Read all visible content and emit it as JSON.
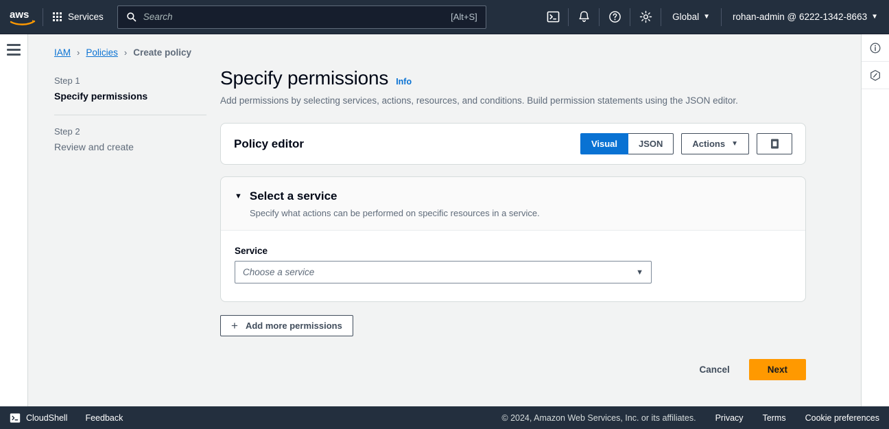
{
  "topnav": {
    "logo_alt": "aws",
    "services_label": "Services",
    "search": {
      "placeholder": "Search",
      "value": "",
      "shortcut": "[Alt+S]"
    },
    "icons": [
      "cloudshell-icon",
      "notifications-bell-icon",
      "help-circle-icon",
      "settings-gear-icon"
    ],
    "region_label": "Global",
    "account_label": "rohan-admin @ 6222-1342-8663",
    "caret": "▼"
  },
  "breadcrumb": {
    "items": [
      {
        "label": "IAM",
        "link": true
      },
      {
        "label": "Policies",
        "link": true
      },
      {
        "label": "Create policy",
        "link": false
      }
    ],
    "separator": "›"
  },
  "steps": [
    {
      "num": "Step 1",
      "label": "Specify permissions",
      "active": true
    },
    {
      "num": "Step 2",
      "label": "Review and create",
      "active": false
    }
  ],
  "page": {
    "title": "Specify permissions",
    "info_label": "Info",
    "subtitle": "Add permissions by selecting services, actions, resources, and conditions. Build permission statements using the JSON editor."
  },
  "policy_editor": {
    "title": "Policy editor",
    "segmented": [
      {
        "label": "Visual",
        "selected": true
      },
      {
        "label": "JSON",
        "selected": false
      }
    ],
    "actions_label": "Actions",
    "actions_caret": "▼",
    "panel_toggle_icon": "panel-square-icon"
  },
  "service_section": {
    "expand_caret": "▼",
    "title": "Select a service",
    "description": "Specify what actions can be performed on specific resources in a service.",
    "field_label": "Service",
    "select_placeholder": "Choose a service",
    "select_value": "",
    "select_caret": "▼"
  },
  "add_more": {
    "plus": "+",
    "label": "Add more permissions"
  },
  "wizard_actions": {
    "cancel_label": "Cancel",
    "next_label": "Next"
  },
  "right_rail": {
    "icons": [
      "info-circle-icon",
      "hexagon-shell-icon"
    ]
  },
  "footer": {
    "cloudshell_label": "CloudShell",
    "feedback_label": "Feedback",
    "copyright": "© 2024, Amazon Web Services, Inc. or its affiliates.",
    "links": [
      "Privacy",
      "Terms",
      "Cookie preferences"
    ]
  },
  "colors": {
    "nav_bg": "#232f3e",
    "accent_blue": "#0972d3",
    "primary_orange": "#ff9900",
    "page_bg": "#f2f3f3",
    "link_blue": "#0972d3"
  }
}
